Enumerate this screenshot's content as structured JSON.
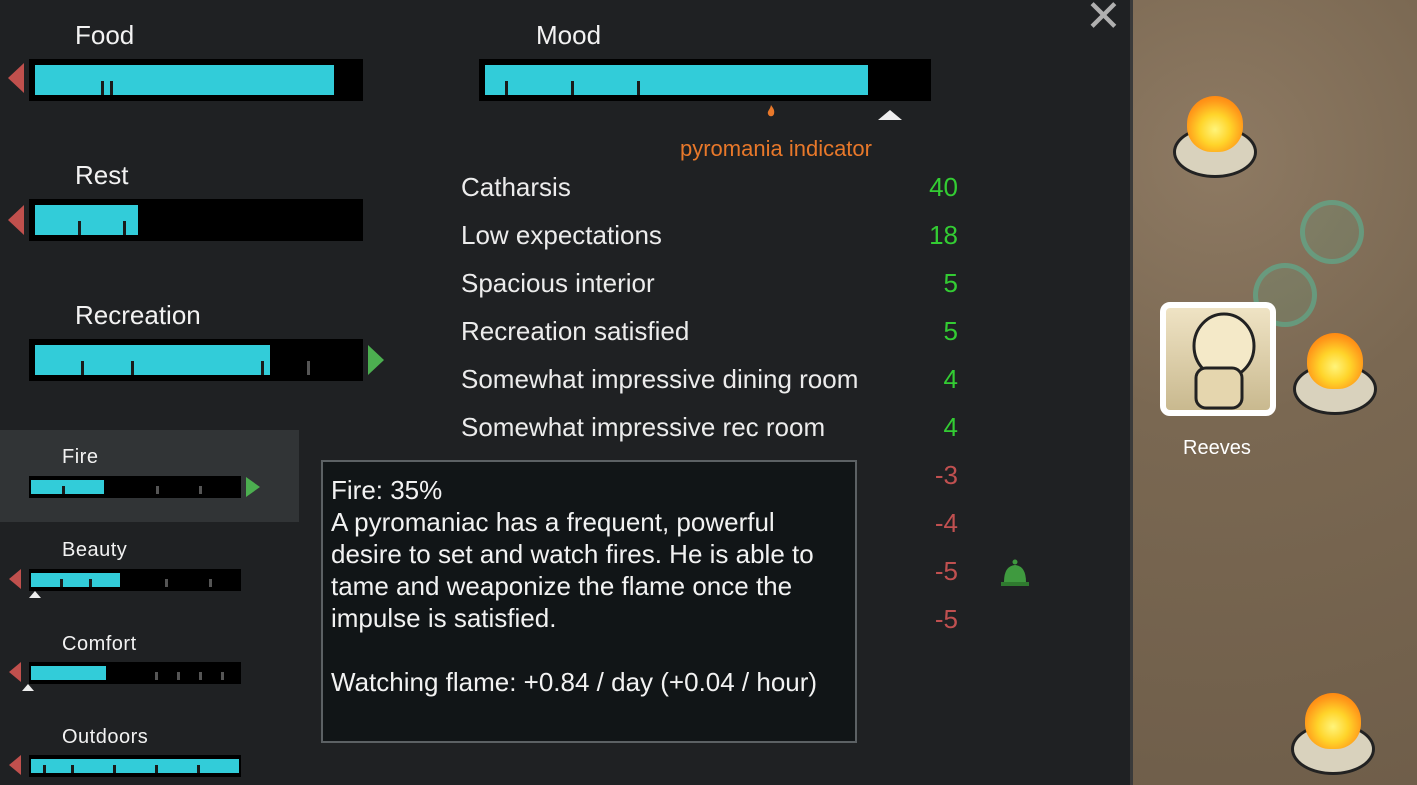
{
  "needs": {
    "food": {
      "label": "Food",
      "level": 0.93
    },
    "rest": {
      "label": "Rest",
      "level": 0.32
    },
    "recreation": {
      "label": "Recreation",
      "level": 0.73
    },
    "mood": {
      "label": "Mood",
      "level": 0.87
    }
  },
  "sub_needs": [
    {
      "label": "Fire",
      "level": 0.35
    },
    {
      "label": "Beauty",
      "level": 0.43
    },
    {
      "label": "Comfort",
      "level": 0.36
    },
    {
      "label": "Outdoors",
      "level": 1.0
    }
  ],
  "pyromania_label": "pyromania indicator",
  "thoughts": [
    {
      "label": "Catharsis",
      "value": "40"
    },
    {
      "label": "Low expectations",
      "value": "18"
    },
    {
      "label": "Spacious interior",
      "value": "5"
    },
    {
      "label": "Recreation satisfied",
      "value": "5"
    },
    {
      "label": "Somewhat impressive dining room",
      "value": "4"
    },
    {
      "label": "Somewhat impressive rec room",
      "value": "4"
    },
    {
      "label": "",
      "value": "-3"
    },
    {
      "label": "",
      "value": "-4"
    },
    {
      "label": "",
      "value": "-5"
    },
    {
      "label": "",
      "value": "-5"
    }
  ],
  "tooltip": {
    "title": "Fire: 35%",
    "body": "A pyromaniac has a frequent, powerful desire to set and watch fires. He is able to tame and weaponize the flame once the impulse is satisfied.",
    "rate": "Watching flame: +0.84 / day (+0.04 / hour)"
  },
  "pawn": {
    "name": "Reeves"
  },
  "colors": {
    "bar_fill": "#32ccd9",
    "positive": "#33cc33",
    "negative": "#c05050",
    "pyro": "#e8782a"
  },
  "icons": {
    "close": "close-icon",
    "bell": "bell-icon"
  }
}
